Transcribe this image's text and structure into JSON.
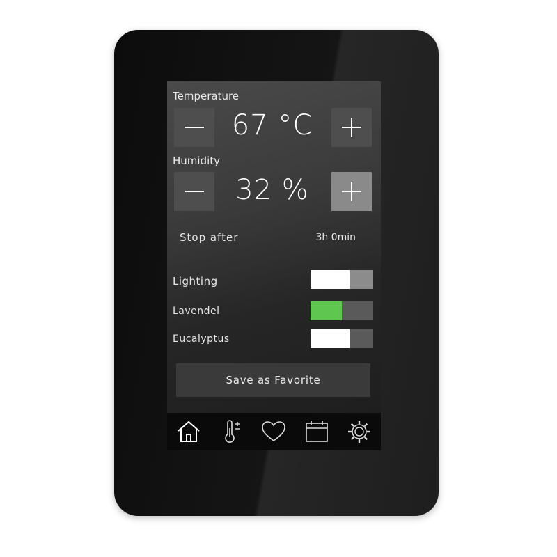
{
  "temperature": {
    "label": "Temperature",
    "value": "67 °C",
    "decrement_icon": "minus-icon",
    "increment_icon": "plus-icon"
  },
  "humidity": {
    "label": "Humidity",
    "value": "32 %",
    "decrement_icon": "minus-icon",
    "increment_icon": "plus-icon"
  },
  "stop_after": {
    "label": "Stop after",
    "value": "3h 0min"
  },
  "toggles": [
    {
      "label": "Lighting",
      "state": "on",
      "color": "#ffffff"
    },
    {
      "label": "Lavendel",
      "state": "on",
      "color": "#5fc750"
    },
    {
      "label": "Eucalyptus",
      "state": "on",
      "color": "#ffffff"
    }
  ],
  "save_button": {
    "label": "Save as Favorite"
  },
  "nav": [
    {
      "icon": "home-icon",
      "active": true
    },
    {
      "icon": "thermometer-plus-icon",
      "active": false
    },
    {
      "icon": "heart-icon",
      "active": false
    },
    {
      "icon": "calendar-icon",
      "active": false
    },
    {
      "icon": "gear-icon",
      "active": false
    }
  ],
  "colors": {
    "accent_green": "#5fc750",
    "screen_bg": "#2e2e2e",
    "device_bezel": "#111111"
  }
}
